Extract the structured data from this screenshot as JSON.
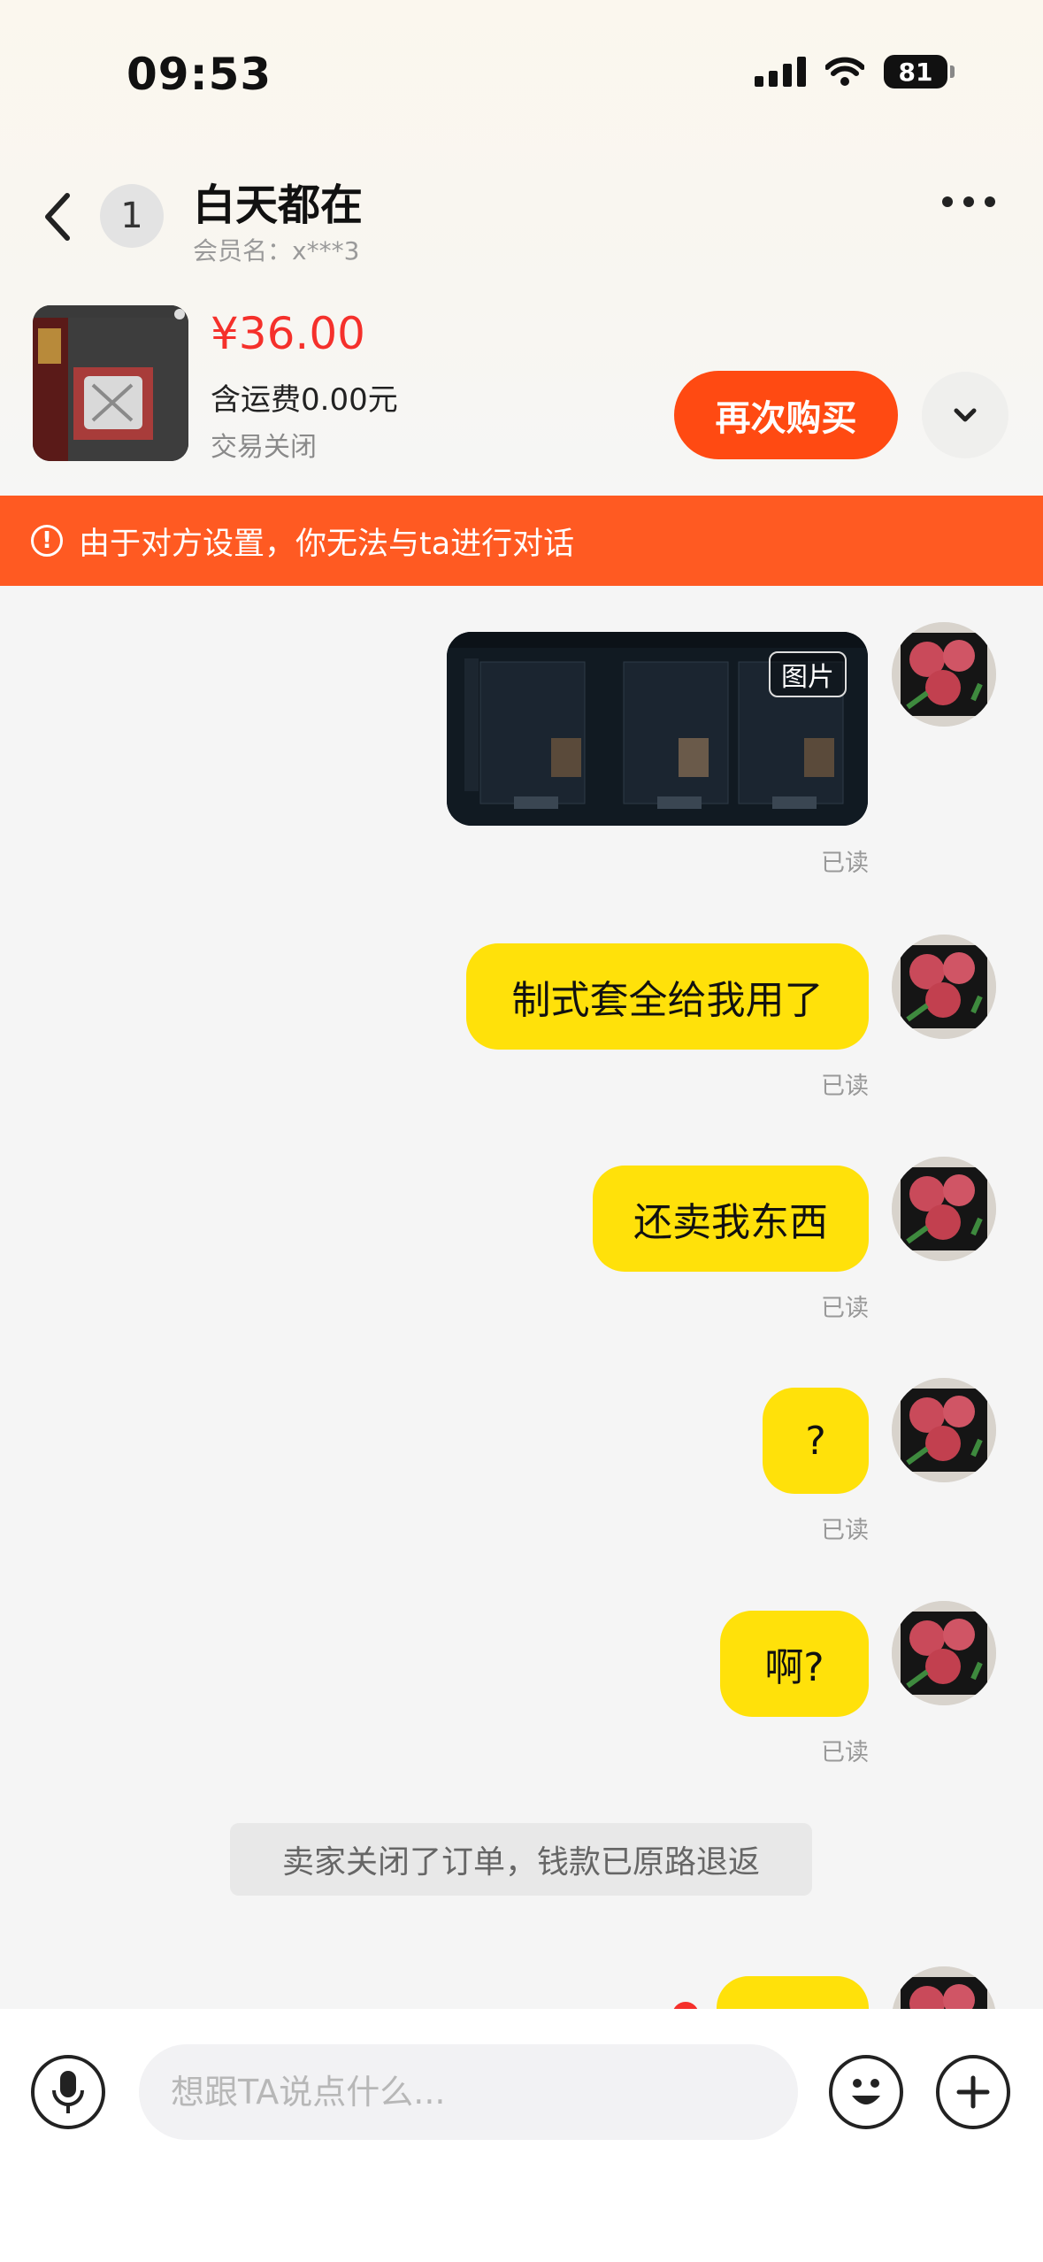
{
  "status_bar": {
    "time": "09:53",
    "battery": "81"
  },
  "header": {
    "unread_count": "1",
    "contact_name": "白天都在",
    "member_name": "会员名：x***3",
    "back_icon": "chevron-left-icon",
    "more_icon": "more-dots-icon"
  },
  "product": {
    "price": "¥36.00",
    "shipping": "含运费0.00元",
    "status": "交易关闭",
    "rebuy_label": "再次购买",
    "expand_icon": "chevron-down-icon"
  },
  "warning": {
    "text": "由于对方设置，你无法与ta进行对话",
    "icon": "alert-circle-icon"
  },
  "messages": [
    {
      "type": "image",
      "tag": "图片",
      "read": "已读"
    },
    {
      "type": "text",
      "text": "制式套全给我用了",
      "read": "已读"
    },
    {
      "type": "text",
      "text": "还卖我东西",
      "read": "已读"
    },
    {
      "type": "text",
      "text": "?",
      "read": "已读"
    },
    {
      "type": "text",
      "text": "啊?",
      "read": "已读"
    }
  ],
  "system_notice": "卖家关闭了订单，钱款已原路退返",
  "input": {
    "placeholder": "想跟TA说点什么..."
  },
  "colors": {
    "accent": "#ff4a12",
    "bubble": "#ffe10a",
    "banner": "#ff5a22",
    "price": "#f5302b"
  }
}
